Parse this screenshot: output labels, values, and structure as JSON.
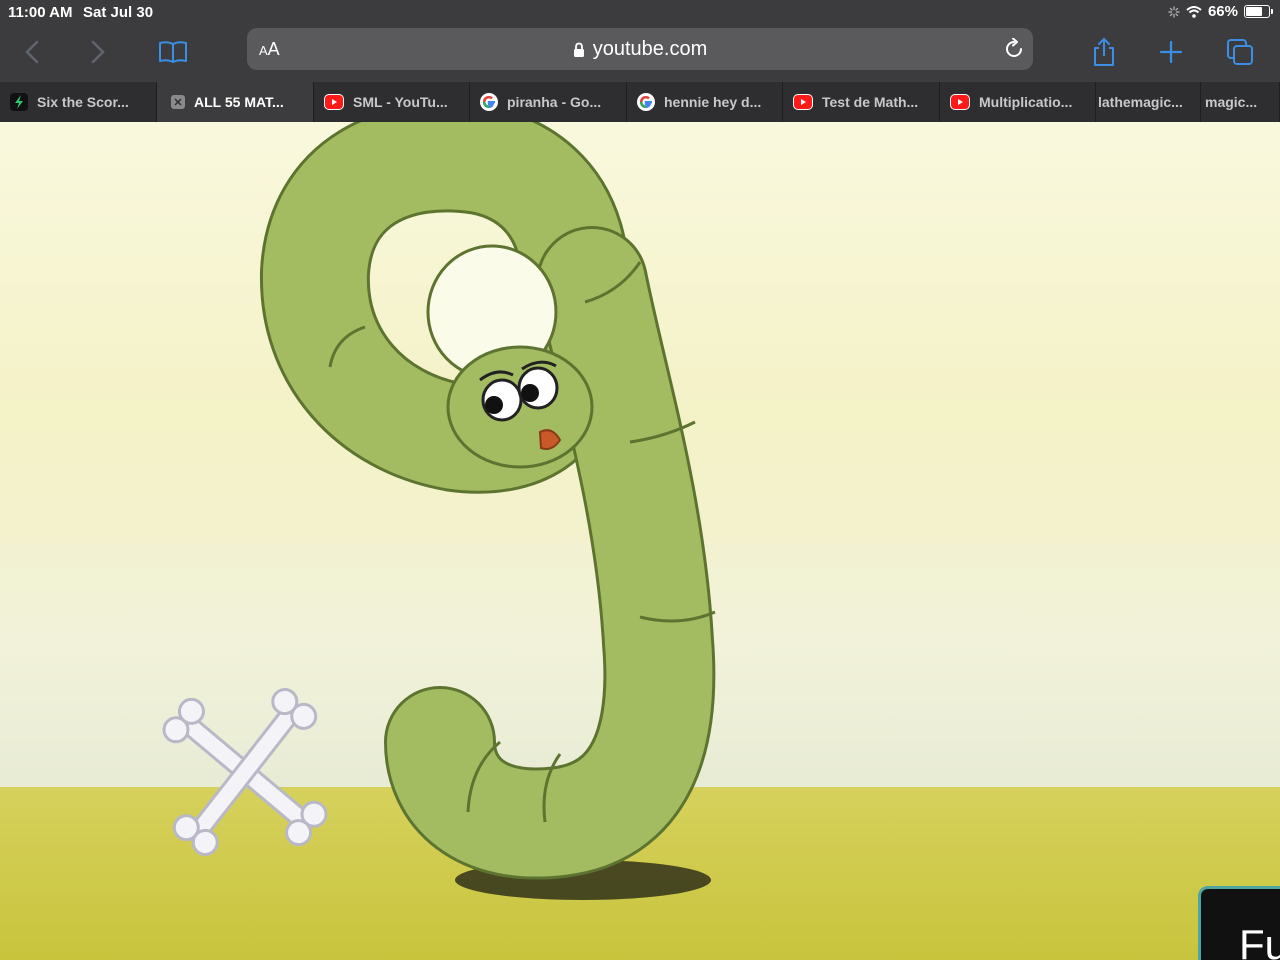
{
  "status": {
    "time": "11:00 AM",
    "date": "Sat Jul 30",
    "battery": "66%",
    "battery_level": 0.66
  },
  "toolbar": {
    "icons": [
      "back-icon",
      "forward-icon",
      "bookmarks-icon",
      "share-icon",
      "new-tab-icon",
      "tabs-overview-icon"
    ],
    "accent": "#3a8ee6"
  },
  "url_bar": {
    "aa_small": "A",
    "aa_large": "A",
    "url": "youtube.com"
  },
  "tabs": [
    {
      "label": "Six the Scor...",
      "favicon": "score-favicon"
    },
    {
      "label": "ALL 55 MAT...",
      "favicon": "close-icon",
      "active": true
    },
    {
      "label": "SML - YouTu...",
      "favicon": "youtube-favicon"
    },
    {
      "label": "piranha - Go...",
      "favicon": "google-favicon"
    },
    {
      "label": "hennie hey d...",
      "favicon": "google-favicon"
    },
    {
      "label": "Test de Math...",
      "favicon": "youtube-favicon"
    },
    {
      "label": "Multiplicatio...",
      "favicon": "youtube-favicon"
    },
    {
      "label": "lathemagic...",
      "favicon": "none"
    },
    {
      "label": "magic...",
      "favicon": "none"
    }
  ],
  "video": {
    "caption_partial": "Fu",
    "caption_accent": "#4fa5a0"
  }
}
